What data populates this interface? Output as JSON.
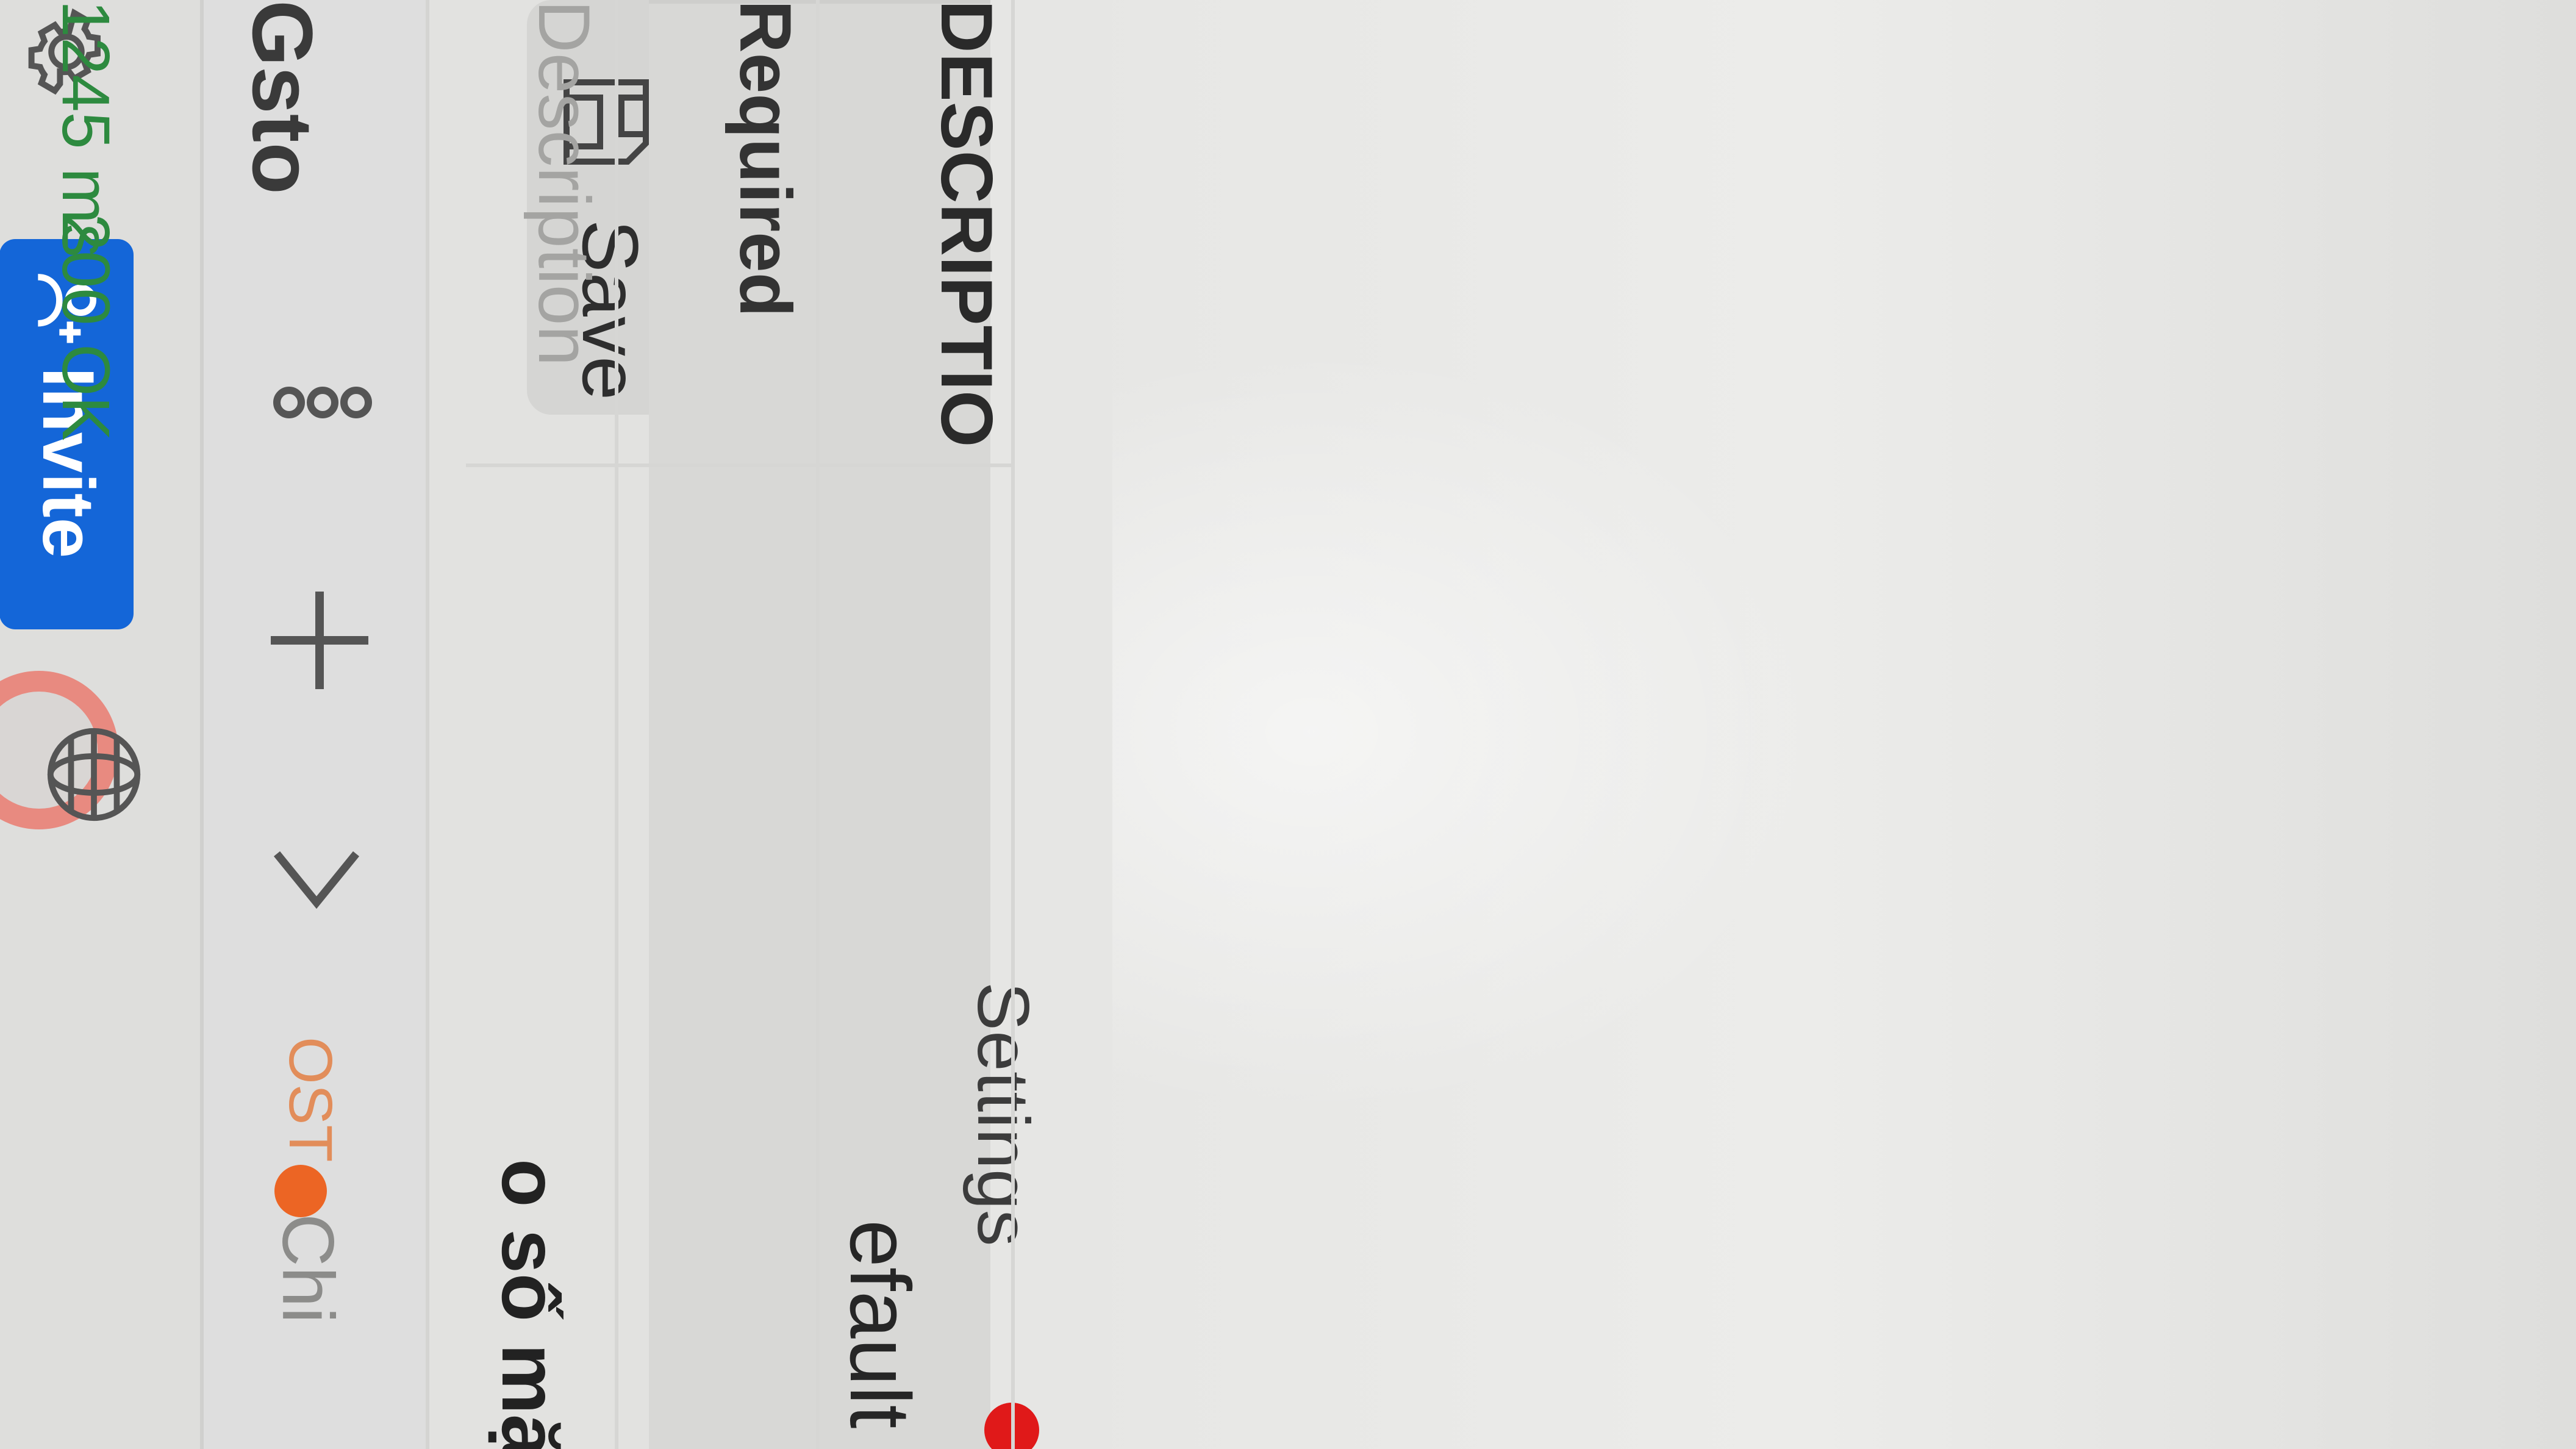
{
  "header": {
    "invite_label": "Invite"
  },
  "tabs": {
    "active": {
      "method": "OST",
      "label": "Chi"
    },
    "environment_label": "Gsto"
  },
  "request": {
    "title": "o số mặc ...",
    "save_label": "Save",
    "environment_value": "efault"
  },
  "request_tabs": {
    "settings_label": "Settings"
  },
  "params_table": {
    "header_description": "DESCRIPTIO",
    "row_required": "Required",
    "description_placeholder": "Description"
  },
  "status": {
    "code": "200 OK",
    "time": "1245 ms"
  },
  "colors": {
    "accent": "#1466d8",
    "status_ok": "#2d8a3f",
    "unsaved_dot": "#ec6524",
    "alert_dot": "#e01919"
  }
}
